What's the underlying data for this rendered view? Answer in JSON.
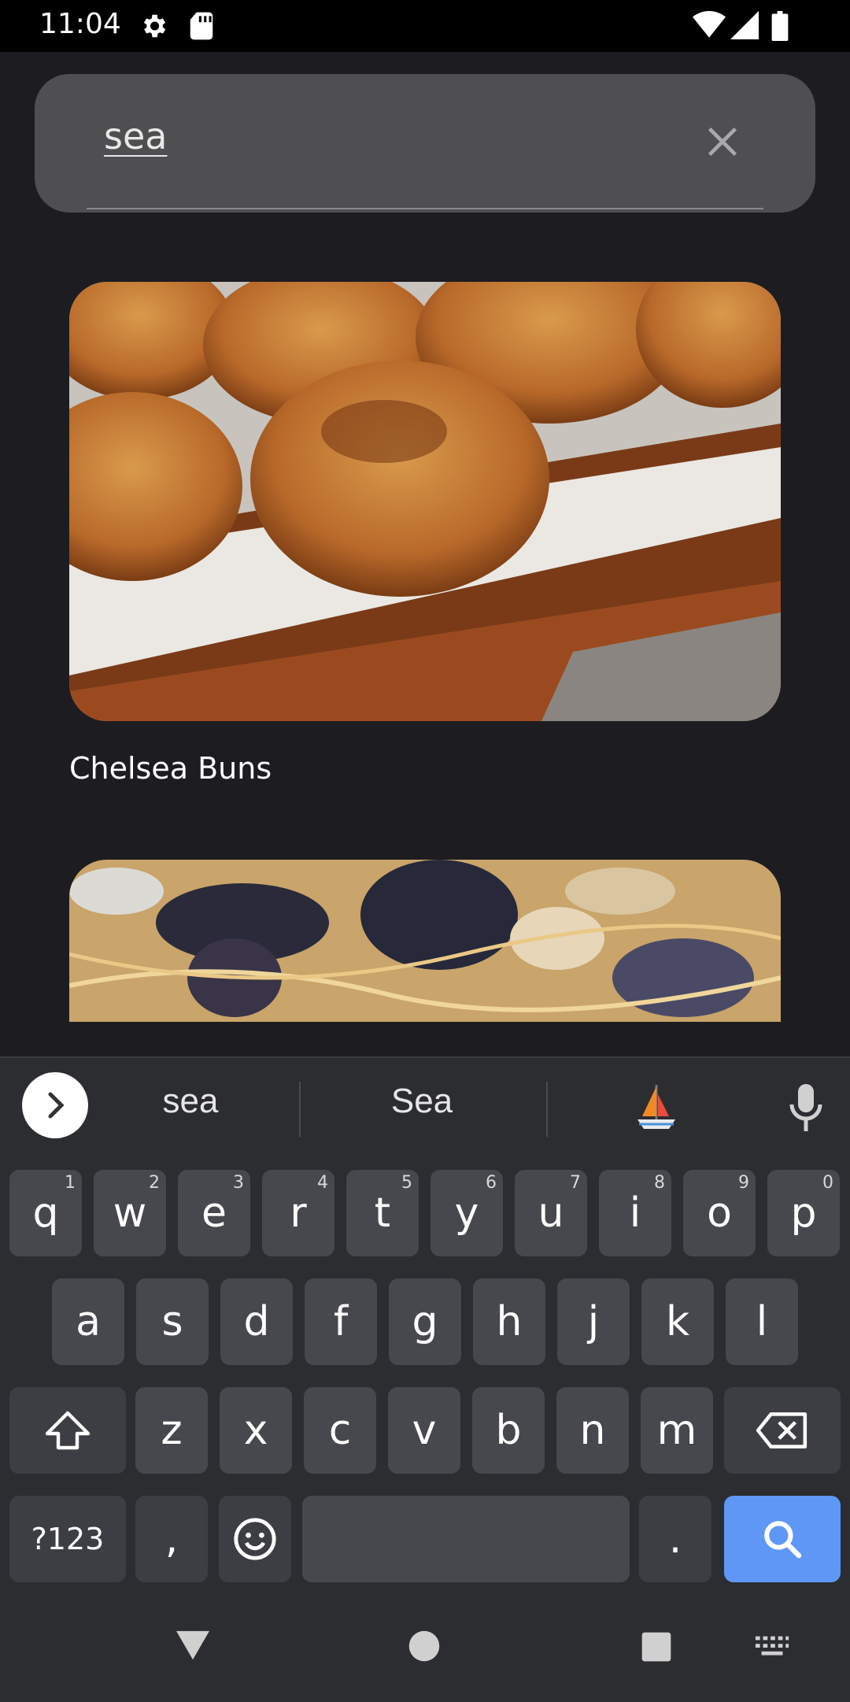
{
  "status_bar": {
    "time": "11:04"
  },
  "search": {
    "query": "sea"
  },
  "results": [
    {
      "title": "Chelsea Buns"
    },
    {
      "title": ""
    }
  ],
  "keyboard": {
    "suggestions": [
      "sea",
      "Sea"
    ],
    "row1": [
      {
        "l": "q",
        "n": "1"
      },
      {
        "l": "w",
        "n": "2"
      },
      {
        "l": "e",
        "n": "3"
      },
      {
        "l": "r",
        "n": "4"
      },
      {
        "l": "t",
        "n": "5"
      },
      {
        "l": "y",
        "n": "6"
      },
      {
        "l": "u",
        "n": "7"
      },
      {
        "l": "i",
        "n": "8"
      },
      {
        "l": "o",
        "n": "9"
      },
      {
        "l": "p",
        "n": "0"
      }
    ],
    "row2": [
      "a",
      "s",
      "d",
      "f",
      "g",
      "h",
      "j",
      "k",
      "l"
    ],
    "row3": [
      "z",
      "x",
      "c",
      "v",
      "b",
      "n",
      "m"
    ],
    "symbols_label": "?123",
    "comma": ",",
    "period": "."
  },
  "colors": {
    "accent": "#5e97f6",
    "background": "#1d1c21",
    "search_bg": "#4f4f51"
  },
  "icons": [
    "settings-icon",
    "sd-card-icon",
    "wifi-icon",
    "signal-icon",
    "battery-icon",
    "close-icon",
    "chevron-right-icon",
    "sailboat-emoji-icon",
    "mic-icon",
    "shift-icon",
    "backspace-icon",
    "emoji-icon",
    "search-icon",
    "back-icon",
    "home-icon",
    "recents-icon",
    "keyboard-icon"
  ]
}
